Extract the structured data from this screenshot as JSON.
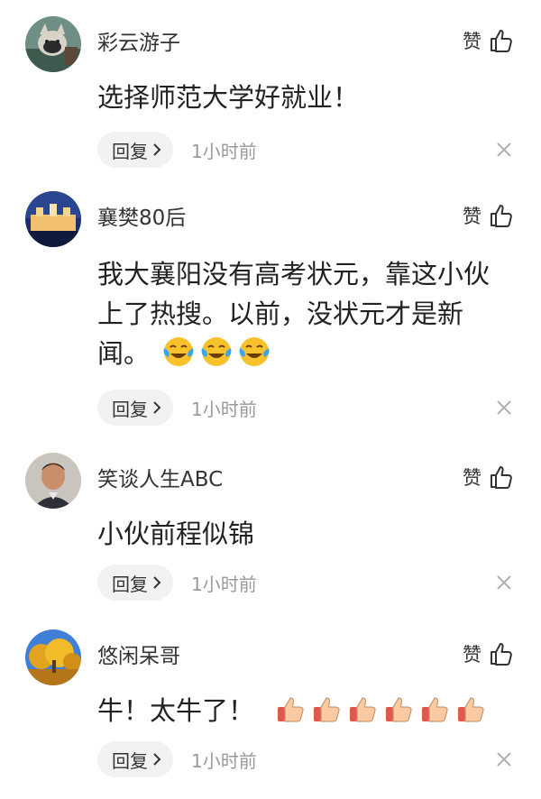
{
  "comments": [
    {
      "username": "彩云游子",
      "text": "选择师范大学好就业！",
      "like_label": "赞",
      "reply_label": "回复",
      "time": "1小时前",
      "avatar_icon": "cat-photo-avatar"
    },
    {
      "username": "襄樊80后",
      "text_lines": [
        "我大襄阳没有高考状元，靠这小伙",
        "上了热搜。以前，没状元才是新",
        "闻。"
      ],
      "trailing_emoji": [
        "crying-laugh-emoji",
        "crying-laugh-emoji",
        "crying-laugh-emoji"
      ],
      "like_label": "赞",
      "reply_label": "回复",
      "time": "1小时前",
      "avatar_icon": "night-building-avatar"
    },
    {
      "username": "笑谈人生ABC",
      "text": "小伙前程似锦",
      "like_label": "赞",
      "reply_label": "回复",
      "time": "1小时前",
      "avatar_icon": "man-portrait-avatar"
    },
    {
      "username": "悠闲呆哥",
      "text": "牛！太牛了！",
      "trailing_emoji": [
        "thumbs-up-emoji",
        "thumbs-up-emoji",
        "thumbs-up-emoji",
        "thumbs-up-emoji",
        "thumbs-up-emoji",
        "thumbs-up-emoji"
      ],
      "like_label": "赞",
      "reply_label": "回复",
      "time": "1小时前",
      "avatar_icon": "autumn-tree-avatar"
    }
  ],
  "colors": {
    "reply_bg": "#f2f2f2",
    "muted_text": "#9a9a9a",
    "primary_text": "#222222"
  }
}
